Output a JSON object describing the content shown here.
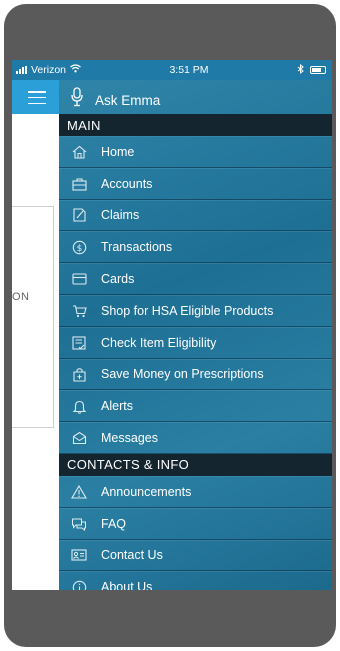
{
  "status_bar": {
    "carrier": "Verizon",
    "time": "3:51 PM"
  },
  "background_app": {
    "card_text": "ON"
  },
  "menu": {
    "ask_label": "Ask Emma",
    "sections": [
      {
        "title": "MAIN",
        "items": [
          {
            "label": "Home",
            "icon": "home-icon"
          },
          {
            "label": "Accounts",
            "icon": "briefcase-icon"
          },
          {
            "label": "Claims",
            "icon": "claims-icon"
          },
          {
            "label": "Transactions",
            "icon": "dollar-circle-icon"
          },
          {
            "label": "Cards",
            "icon": "card-icon"
          },
          {
            "label": "Shop for HSA Eligible Products",
            "icon": "cart-icon"
          },
          {
            "label": "Check Item Eligibility",
            "icon": "checklist-icon"
          },
          {
            "label": "Save Money on Prescriptions",
            "icon": "prescription-bag-icon"
          },
          {
            "label": "Alerts",
            "icon": "bell-icon"
          },
          {
            "label": "Messages",
            "icon": "envelope-icon"
          }
        ]
      },
      {
        "title": "CONTACTS & INFO",
        "items": [
          {
            "label": "Announcements",
            "icon": "warning-icon"
          },
          {
            "label": "FAQ",
            "icon": "chat-icon"
          },
          {
            "label": "Contact Us",
            "icon": "contact-card-icon"
          },
          {
            "label": "About Us",
            "icon": "info-icon"
          }
        ]
      }
    ]
  }
}
